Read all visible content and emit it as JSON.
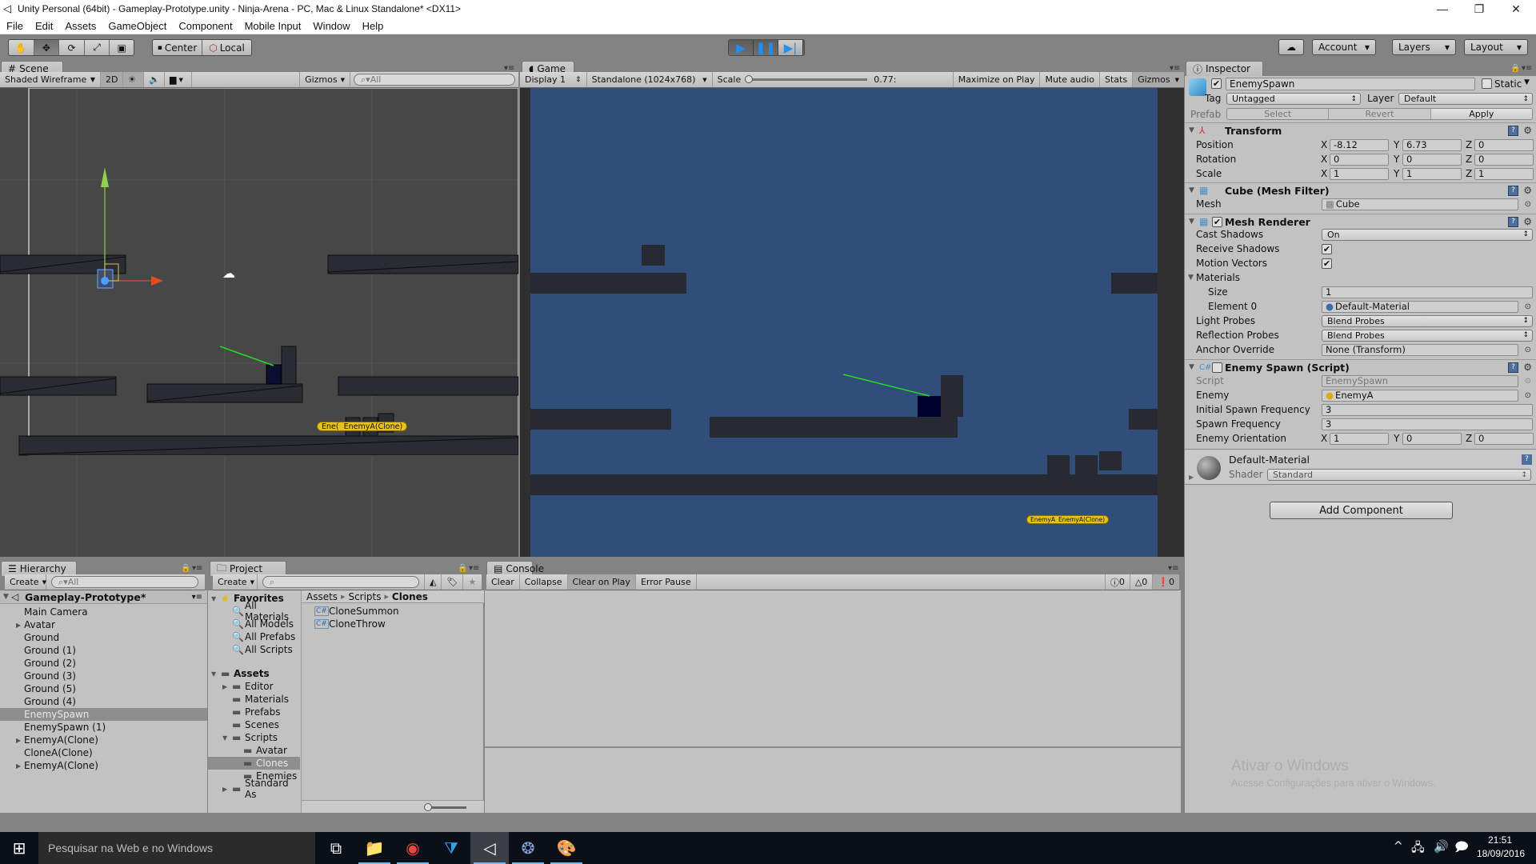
{
  "window": {
    "title": "Unity Personal (64bit) - Gameplay-Prototype.unity - Ninja-Arena - PC, Mac & Linux Standalone* <DX11>",
    "minimize": "—",
    "maximize": "❐",
    "close": "✕"
  },
  "menu": [
    "File",
    "Edit",
    "Assets",
    "GameObject",
    "Component",
    "Mobile Input",
    "Window",
    "Help"
  ],
  "toolbar": {
    "tools": [
      "hand-tool",
      "move-tool",
      "rotate-tool",
      "scale-tool",
      "rect-tool"
    ],
    "active_tool": "move-tool",
    "pivot": "Center",
    "space": "Local",
    "play_state": "playing",
    "account": "Account",
    "layers": "Layers",
    "layout": "Layout"
  },
  "scene": {
    "tab": "Scene",
    "draw_mode": "Shaded Wireframe",
    "mode_2d": "2D",
    "gizmos": "Gizmos",
    "search_placeholder": "All",
    "labels": [
      "Ene(",
      "EnemyA(Clone)"
    ]
  },
  "game": {
    "tab": "Game",
    "display": "Display 1",
    "resolution": "Standalone (1024x768)",
    "scale_label": "Scale",
    "scale_value": "0.77:",
    "maximize_on_play": "Maximize on Play",
    "mute_audio": "Mute audio",
    "stats": "Stats",
    "gizmos": "Gizmos",
    "labels": [
      "EnemyA",
      "EnemyA(Clone)"
    ],
    "background_color": "#314e7a"
  },
  "inspector": {
    "tab": "Inspector",
    "object_name": "EnemySpawn",
    "active": true,
    "static_label": "Static",
    "tag_label": "Tag",
    "tag": "Untagged",
    "layer_label": "Layer",
    "layer": "Default",
    "prefab_label": "Prefab",
    "prefab_select": "Select",
    "prefab_revert": "Revert",
    "prefab_apply": "Apply",
    "transform": {
      "title": "Transform",
      "position_label": "Position",
      "position": {
        "x": "-8.12",
        "y": "6.73",
        "z": "0"
      },
      "rotation_label": "Rotation",
      "rotation": {
        "x": "0",
        "y": "0",
        "z": "0"
      },
      "scale_label": "Scale",
      "scale": {
        "x": "1",
        "y": "1",
        "z": "1"
      }
    },
    "mesh_filter": {
      "title": "Cube (Mesh Filter)",
      "mesh_label": "Mesh",
      "mesh": "Cube"
    },
    "mesh_renderer": {
      "title": "Mesh Renderer",
      "cast_shadows_label": "Cast Shadows",
      "cast_shadows": "On",
      "receive_shadows_label": "Receive Shadows",
      "motion_vectors_label": "Motion Vectors",
      "materials_label": "Materials",
      "size_label": "Size",
      "size": "1",
      "element0_label": "Element 0",
      "element0": "Default-Material",
      "light_probes_label": "Light Probes",
      "light_probes": "Blend Probes",
      "reflection_probes_label": "Reflection Probes",
      "reflection_probes": "Blend Probes",
      "anchor_override_label": "Anchor Override",
      "anchor_override": "None (Transform)"
    },
    "enemy_spawn": {
      "title": "Enemy Spawn (Script)",
      "script_label": "Script",
      "script": "EnemySpawn",
      "enemy_label": "Enemy",
      "enemy": "EnemyA",
      "initial_label": "Initial Spawn Frequency",
      "initial": "3",
      "freq_label": "Spawn Frequency",
      "freq": "3",
      "orient_label": "Enemy Orientation",
      "orient": {
        "x": "1",
        "y": "0",
        "z": "0"
      }
    },
    "material": {
      "name": "Default-Material",
      "shader_label": "Shader",
      "shader": "Standard"
    },
    "add_component": "Add Component",
    "watermark_title": "Ativar o Windows",
    "watermark_sub": "Acesse Configurações para ativar o Windows."
  },
  "hierarchy": {
    "tab": "Hierarchy",
    "create": "Create",
    "search_placeholder": "All",
    "scene_name": "Gameplay-Prototype*",
    "items": [
      {
        "label": "Main Camera",
        "expandable": false
      },
      {
        "label": "Avatar",
        "expandable": true
      },
      {
        "label": "Ground",
        "expandable": false
      },
      {
        "label": "Ground (1)",
        "expandable": false
      },
      {
        "label": "Ground (2)",
        "expandable": false
      },
      {
        "label": "Ground (3)",
        "expandable": false
      },
      {
        "label": "Ground (5)",
        "expandable": false
      },
      {
        "label": "Ground (4)",
        "expandable": false
      },
      {
        "label": "EnemySpawn",
        "expandable": false,
        "selected": true
      },
      {
        "label": "EnemySpawn (1)",
        "expandable": false
      },
      {
        "label": "EnemyA(Clone)",
        "expandable": true
      },
      {
        "label": "CloneA(Clone)",
        "expandable": false
      },
      {
        "label": "EnemyA(Clone)",
        "expandable": true
      }
    ]
  },
  "project": {
    "tab": "Project",
    "create": "Create",
    "favorites_label": "Favorites",
    "favorites": [
      "All Materials",
      "All Models",
      "All Prefabs",
      "All Scripts"
    ],
    "assets_label": "Assets",
    "folders": [
      {
        "label": "Editor",
        "depth": 1,
        "expandable": true
      },
      {
        "label": "Materials",
        "depth": 1
      },
      {
        "label": "Prefabs",
        "depth": 1
      },
      {
        "label": "Scenes",
        "depth": 1
      },
      {
        "label": "Scripts",
        "depth": 1,
        "expanded": true
      },
      {
        "label": "Avatar",
        "depth": 2
      },
      {
        "label": "Clones",
        "depth": 2,
        "selected": true
      },
      {
        "label": "Enemies",
        "depth": 2
      },
      {
        "label": "Standard As",
        "depth": 1,
        "expandable": true
      }
    ],
    "breadcrumb": [
      "Assets",
      "Scripts",
      "Clones"
    ],
    "files": [
      "CloneSummon",
      "CloneThrow"
    ]
  },
  "console": {
    "tab": "Console",
    "clear": "Clear",
    "collapse": "Collapse",
    "clear_on_play": "Clear on Play",
    "error_pause": "Error Pause",
    "info_count": "0",
    "warning_count": "0",
    "error_count": "0"
  },
  "taskbar": {
    "search_placeholder": "Pesquisar na Web e no Windows",
    "time": "21:51",
    "date": "18/09/2016"
  }
}
